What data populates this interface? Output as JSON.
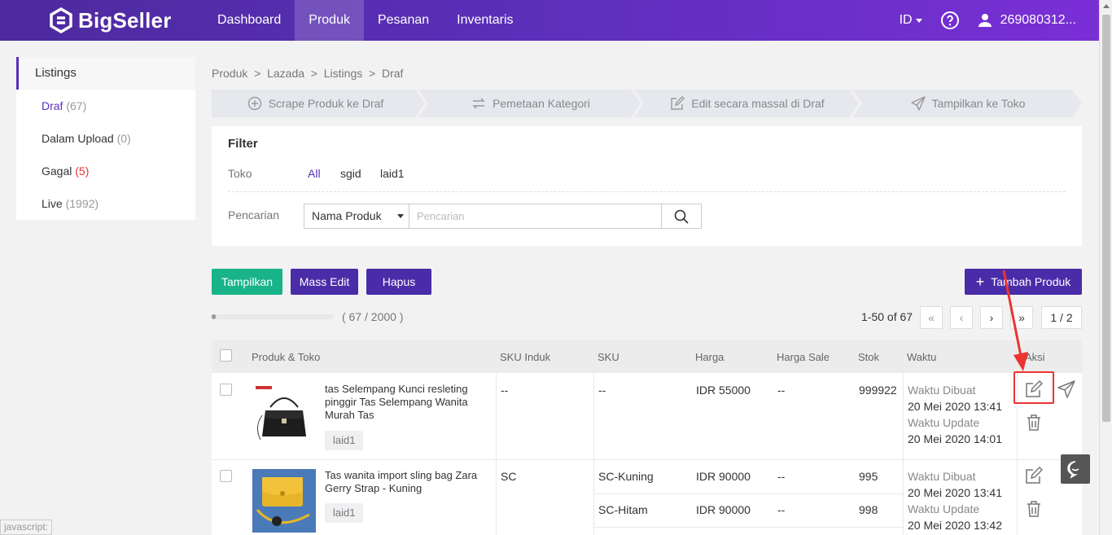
{
  "app": {
    "brand": "BigSeller"
  },
  "nav": {
    "items": [
      "Dashboard",
      "Produk",
      "Pesanan",
      "Inventaris"
    ],
    "active": "Produk"
  },
  "topbar": {
    "lang": "ID",
    "user": "269080312..."
  },
  "sidebar": {
    "title": "Listings",
    "items": [
      {
        "label": "Draf",
        "count": "(67)"
      },
      {
        "label": "Dalam Upload",
        "count": "(0)"
      },
      {
        "label": "Gagal",
        "count": "(5)"
      },
      {
        "label": "Live",
        "count": "(1992)"
      }
    ]
  },
  "breadcrumb": "Produk  >  Lazada  >  Listings  >  Draf",
  "steps": [
    "Scrape Produk ke Draf",
    "Pemetaan Kategori",
    "Edit secara massal di Draf",
    "Tampilkan ke Toko"
  ],
  "filter": {
    "title": "Filter",
    "toko_label": "Toko",
    "toko_options": [
      "All",
      "sgid",
      "laid1"
    ],
    "search_label": "Pencarian",
    "search_type": "Nama Produk",
    "search_placeholder": "Pencarian"
  },
  "actions": {
    "show": "Tampilkan",
    "mass_edit": "Mass Edit",
    "delete": "Hapus",
    "add": "Tambah Produk"
  },
  "quota": {
    "text": "( 67 / 2000 )",
    "used": 67,
    "total": 2000
  },
  "pager": {
    "info": "1-50 of 67",
    "page": "1 / 2",
    "first": "«",
    "prev": "‹",
    "next": "›",
    "last": "»"
  },
  "table": {
    "headers": [
      "Produk & Toko",
      "SKU Induk",
      "SKU",
      "Harga",
      "Harga Sale",
      "Stok",
      "Waktu",
      "Aksi"
    ],
    "rows": [
      {
        "name": "tas Selempang Kunci resleting pinggir Tas Selempang Wanita Murah Tas",
        "shop": "laid1",
        "parent_sku": "--",
        "variants": [
          {
            "sku": "--",
            "price": "IDR 55000",
            "sale": "--",
            "stock": "999922"
          }
        ],
        "created_label": "Waktu Dibuat",
        "created": "20 Mei 2020 13:41",
        "updated_label": "Waktu Update",
        "updated": "20 Mei 2020 14:01"
      },
      {
        "name": "Tas wanita import sling bag Zara Gerry Strap - Kuning",
        "shop": "laid1",
        "parent_sku": "SC",
        "variants": [
          {
            "sku": "SC-Kuning",
            "price": "IDR 90000",
            "sale": "--",
            "stock": "995"
          },
          {
            "sku": "SC-Hitam",
            "price": "IDR 90000",
            "sale": "--",
            "stock": "998"
          }
        ],
        "created_label": "Waktu Dibuat",
        "created": "20 Mei 2020 13:41",
        "updated_label": "Waktu Update",
        "updated": "20 Mei 2020 13:42"
      }
    ]
  },
  "status_hint": "javascript:",
  "colors": {
    "brand": "#5a2fb8",
    "green": "#19b38a",
    "highlight": "#e33333"
  }
}
